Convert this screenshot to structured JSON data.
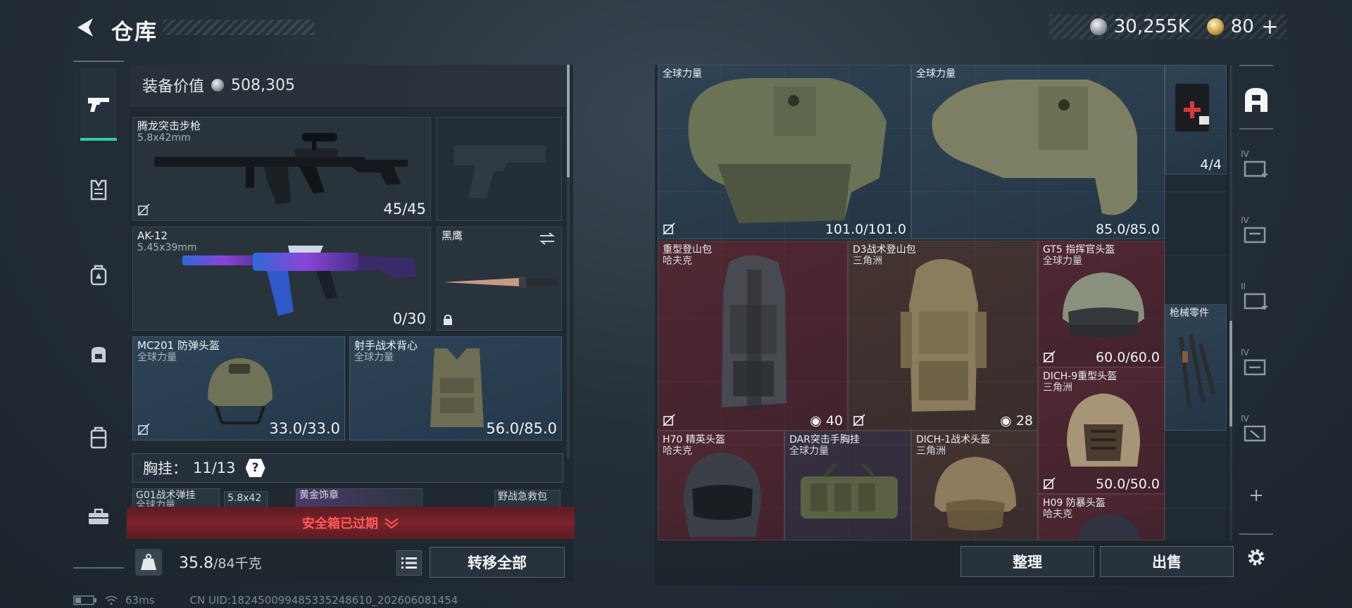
{
  "header": {
    "title": "仓库",
    "silver_amount": "30,255K",
    "gold_amount": "80",
    "gold_add": "+"
  },
  "sidenav": {
    "items": [
      "pistol-icon",
      "vest-icon",
      "backpack-icon",
      "bag-icon",
      "locker-icon",
      "toolbox-icon"
    ]
  },
  "left": {
    "equip_value_label": "装备价值",
    "equip_value": "508,305",
    "primary_weapon": {
      "name": "腾龙突击步枪",
      "caliber": "5.8x42mm",
      "ammo": "45/45"
    },
    "secondary_weapon": {
      "name": "AK-12",
      "caliber": "5.45x39mm",
      "ammo": "0/30"
    },
    "melee": {
      "name": "黑鹰"
    },
    "helmet": {
      "name": "MC201 防弹头盔",
      "origin": "全球力量",
      "durability": "33.0/33.0"
    },
    "armor": {
      "name": "射手战术背心",
      "origin": "全球力量",
      "durability": "56.0/85.0"
    },
    "chest_rig": {
      "label": "胸挂：",
      "capacity": "11/13",
      "help": "?"
    },
    "mini_items": [
      {
        "name": "G01战术弹挂",
        "sub": "全球力量"
      },
      {
        "name": "5.8x42",
        "sub": ""
      },
      {
        "name": "黄金饰章",
        "sub": ""
      },
      {
        "name": "野战急救包",
        "sub": ""
      }
    ],
    "safe_box_text": "安全箱已过期",
    "weight_current": "35.8",
    "weight_capacity": "/84千克",
    "transfer_all": "转移全部"
  },
  "status": {
    "ping": "63ms",
    "uid": "CN UID:182450099485335248610_202606081454"
  },
  "grid": {
    "items": [
      {
        "name": "全球力量",
        "sub": "",
        "qty": "101.0/101.0",
        "color": "blue",
        "art": "vest",
        "corner": true
      },
      {
        "name": "全球力量",
        "sub": "",
        "qty": "85.0/85.0",
        "color": "blue",
        "art": "vest",
        "corner": true
      },
      {
        "name": "",
        "sub": "",
        "qty": "4/4",
        "color": "blue",
        "art": "medkit",
        "corner": false
      },
      {
        "name": "重型登山包",
        "sub": "哈夫克",
        "qty": "40",
        "color": "red",
        "art": "backpack-dark",
        "corner": true,
        "bag": true
      },
      {
        "name": "D3战术登山包",
        "sub": "三角洲",
        "qty": "28",
        "color": "brown",
        "art": "backpack-tan",
        "corner": true,
        "bag": true
      },
      {
        "name": "GT5 指挥官头盔",
        "sub": "全球力量",
        "qty": "60.0/60.0",
        "color": "red",
        "art": "helmet-grey",
        "corner": true
      },
      {
        "name": "枪械零件",
        "sub": "",
        "qty": "",
        "color": "blue",
        "art": "parts",
        "corner": false
      },
      {
        "name": "DICH-9重型头盔",
        "sub": "三角洲",
        "qty": "50.0/50.0",
        "color": "red",
        "art": "helmet-tan",
        "corner": true
      },
      {
        "name": "H70 精英头盔",
        "sub": "哈夫克",
        "qty": "",
        "color": "red",
        "art": "helmet-dark",
        "corner": false
      },
      {
        "name": "DAR突击手胸挂",
        "sub": "全球力量",
        "qty": "",
        "color": "purple",
        "art": "rig",
        "corner": false
      },
      {
        "name": "DICH-1战术头盔",
        "sub": "三角洲",
        "qty": "",
        "color": "brown",
        "art": "helmet-tan",
        "corner": false
      },
      {
        "name": "H09 防暴头盔",
        "sub": "哈夫克",
        "qty": "",
        "color": "red",
        "art": "helmet-dark",
        "corner": false
      }
    ],
    "sort_label": "整理",
    "sell_label": "出售"
  },
  "rail": {
    "items": [
      "safe-icon",
      "crate-iv-icon",
      "crate-iv-2-icon",
      "crate-ii-icon",
      "crate-iv-3-icon",
      "crate-iv-4-icon",
      "add-icon",
      "settings-icon"
    ],
    "tier_labels": [
      "IV",
      "IV",
      "II",
      "IV",
      "IV"
    ]
  }
}
